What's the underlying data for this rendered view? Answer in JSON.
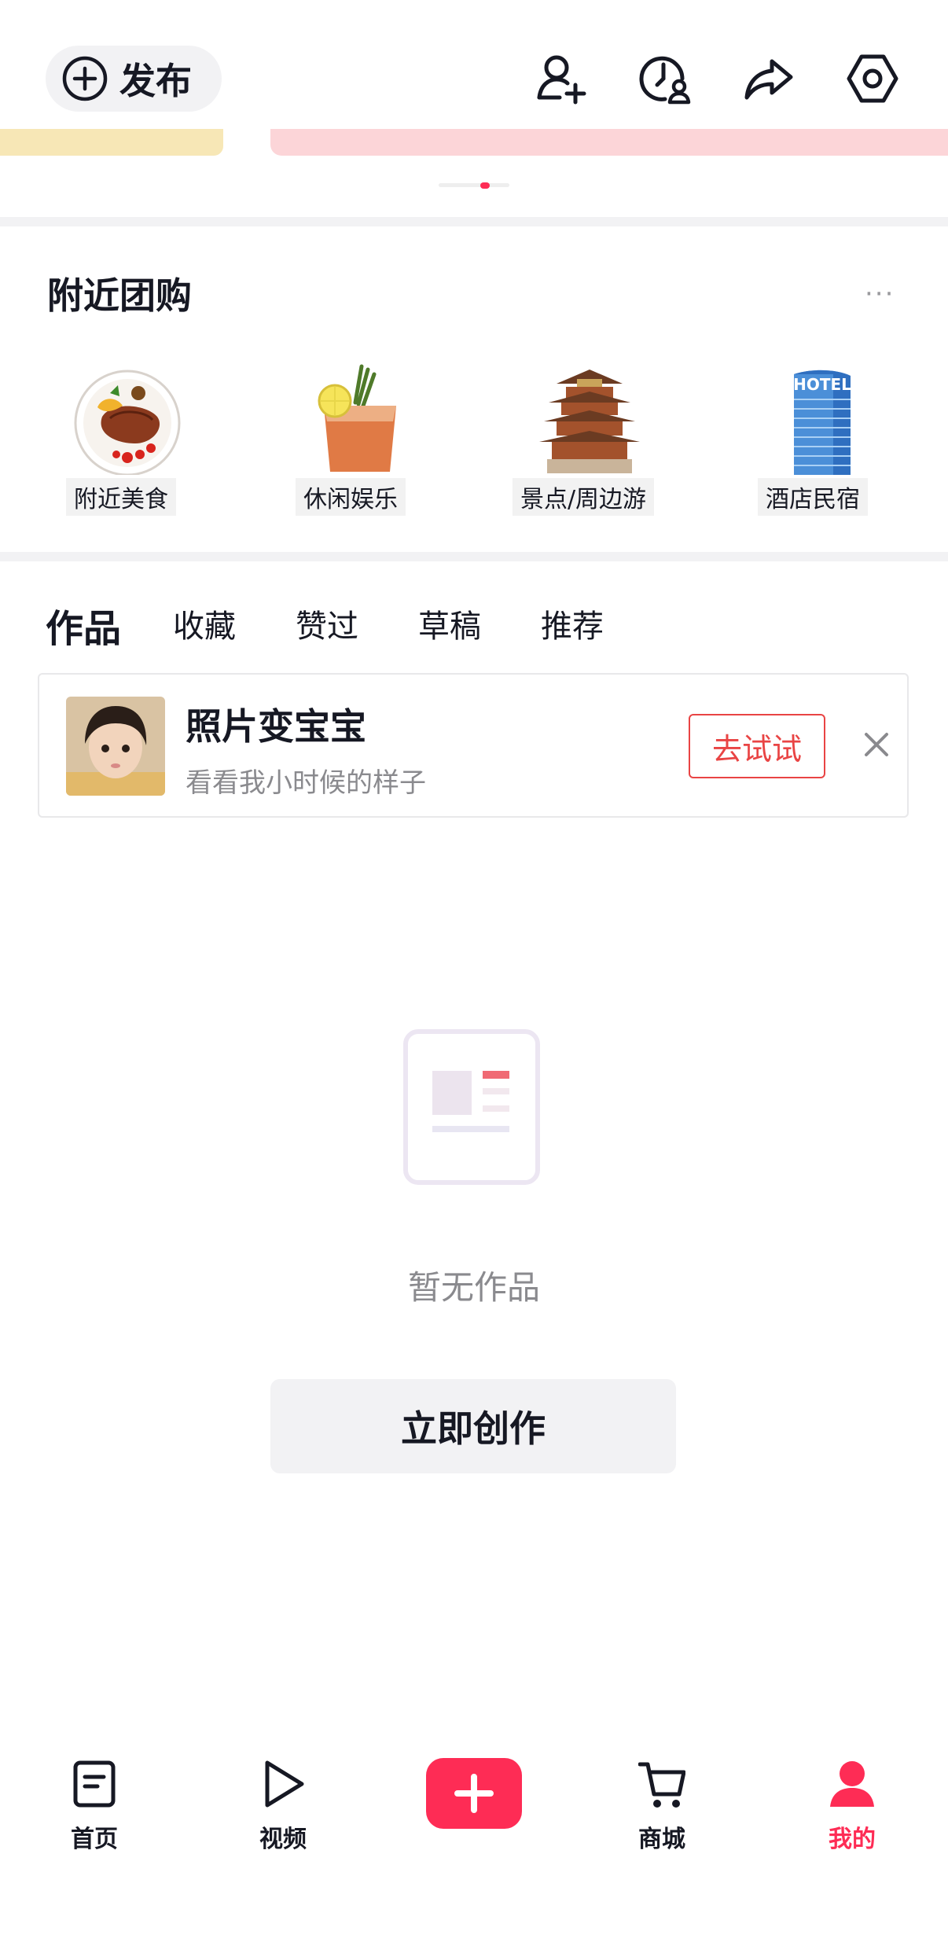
{
  "header": {
    "publish_label": "发布",
    "icons": [
      "add-friend-icon",
      "visitor-icon",
      "share-icon",
      "settings-icon"
    ]
  },
  "group_buy": {
    "title": "附近团购",
    "more": "···",
    "categories": [
      {
        "label": "附近美食",
        "icon": "steak-plate-image"
      },
      {
        "label": "休闲娱乐",
        "icon": "cocktail-image"
      },
      {
        "label": "景点/周边游",
        "icon": "pavilion-image"
      },
      {
        "label": "酒店民宿",
        "icon": "hotel-building-image"
      }
    ]
  },
  "tabs": [
    {
      "label": "作品",
      "active": true
    },
    {
      "label": "收藏",
      "active": false
    },
    {
      "label": "赞过",
      "active": false
    },
    {
      "label": "草稿",
      "active": false
    },
    {
      "label": "推荐",
      "active": false
    }
  ],
  "promo_card": {
    "title": "照片变宝宝",
    "subtitle": "看看我小时候的样子",
    "button": "去试试"
  },
  "empty_state": {
    "text": "暂无作品",
    "button": "立即创作"
  },
  "bottom_nav": [
    {
      "label": "首页",
      "icon": "home-doc-icon",
      "active": false
    },
    {
      "label": "视频",
      "icon": "play-icon",
      "active": false
    },
    {
      "label": "商城",
      "icon": "cart-icon",
      "active": false
    },
    {
      "label": "我的",
      "icon": "person-icon",
      "active": true
    }
  ],
  "colors": {
    "accent": "#fe2c55",
    "try_button": "#e94444",
    "muted_text": "#8a8a8e"
  }
}
